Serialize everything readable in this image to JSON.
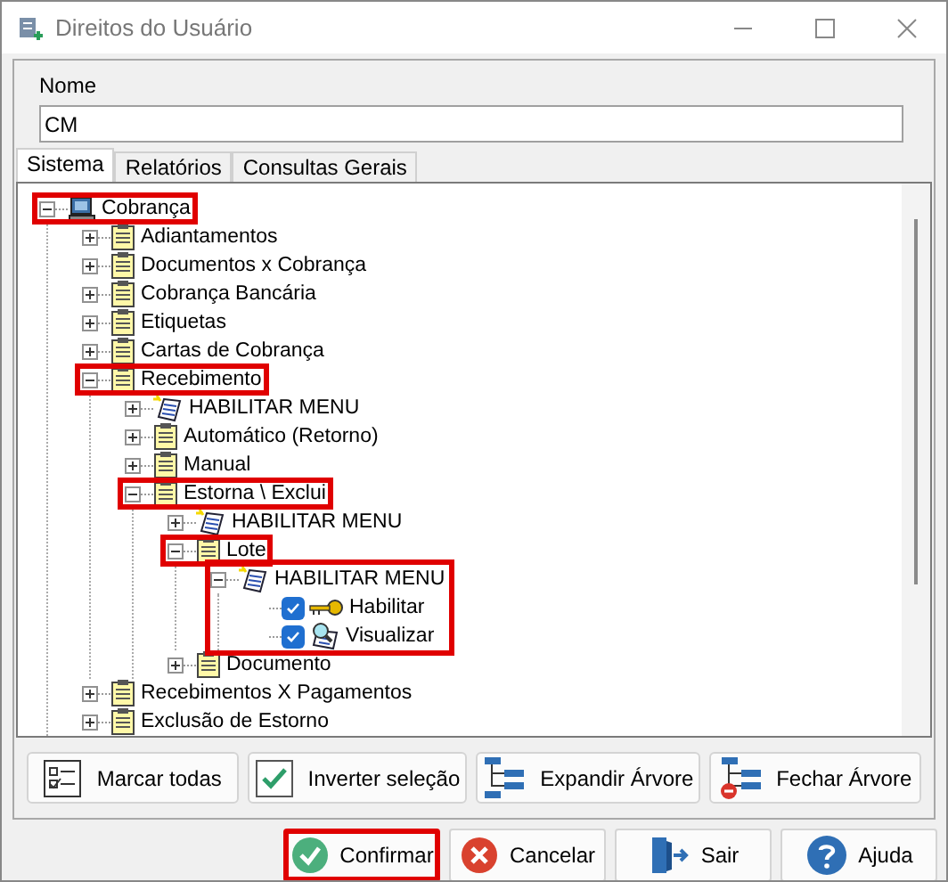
{
  "window": {
    "title": "Direitos do Usuário"
  },
  "name_field": {
    "label": "Nome",
    "value": "CM"
  },
  "tabs": [
    {
      "label": "Sistema",
      "selected": true
    },
    {
      "label": "Relatórios",
      "selected": false
    },
    {
      "label": "Consultas Gerais",
      "selected": false
    }
  ],
  "tree": [
    {
      "label": "Cobrança",
      "kind": "computer",
      "expanded": true,
      "highlighted": true,
      "children": [
        {
          "label": "Adiantamentos",
          "kind": "folder",
          "expanded": false,
          "highlighted": false
        },
        {
          "label": "Documentos x Cobrança",
          "kind": "folder",
          "expanded": false,
          "highlighted": false
        },
        {
          "label": "Cobrança Bancária",
          "kind": "folder",
          "expanded": false,
          "highlighted": false
        },
        {
          "label": "Etiquetas",
          "kind": "folder",
          "expanded": false,
          "highlighted": false
        },
        {
          "label": "Cartas de Cobrança",
          "kind": "folder",
          "expanded": false,
          "highlighted": false
        },
        {
          "label": "Recebimento",
          "kind": "folder",
          "expanded": true,
          "highlighted": true,
          "children": [
            {
              "label": "HABILITAR MENU",
              "kind": "menu",
              "expanded": false,
              "highlighted": false
            },
            {
              "label": "Automático (Retorno)",
              "kind": "folder",
              "expanded": false,
              "highlighted": false
            },
            {
              "label": "Manual",
              "kind": "folder",
              "expanded": false,
              "highlighted": false
            },
            {
              "label": "Estorna \\ Exclui",
              "kind": "folder",
              "expanded": true,
              "highlighted": true,
              "children": [
                {
                  "label": "HABILITAR MENU",
                  "kind": "menu",
                  "expanded": false,
                  "highlighted": false
                },
                {
                  "label": "Lote",
                  "kind": "folder",
                  "expanded": true,
                  "highlighted": true,
                  "children": [
                    {
                      "label": "HABILITAR MENU",
                      "kind": "menu",
                      "expanded": true,
                      "highlighted": true,
                      "children": [
                        {
                          "label": "Habilitar",
                          "kind": "key",
                          "checked": true
                        },
                        {
                          "label": "Visualizar",
                          "kind": "view",
                          "checked": true
                        }
                      ]
                    }
                  ]
                },
                {
                  "label": "Documento",
                  "kind": "folder",
                  "expanded": false,
                  "highlighted": false
                }
              ]
            }
          ]
        },
        {
          "label": "Recebimentos X Pagamentos",
          "kind": "folder",
          "expanded": false,
          "highlighted": false
        },
        {
          "label": "Exclusão de Estorno",
          "kind": "folder",
          "expanded": false,
          "highlighted": false
        }
      ]
    }
  ],
  "tree_buttons": [
    {
      "label": "Marcar todas",
      "kind": "mark"
    },
    {
      "label": "Inverter seleção",
      "kind": "invert"
    },
    {
      "label": "Expandir Árvore",
      "kind": "expand"
    },
    {
      "label": "Fechar Árvore",
      "kind": "collapse"
    }
  ],
  "dialog_buttons": [
    {
      "label": "Confirmar",
      "kind": "confirm",
      "highlighted": true
    },
    {
      "label": "Cancelar",
      "kind": "cancel",
      "highlighted": false
    },
    {
      "label": "Sair",
      "kind": "exit",
      "highlighted": false
    },
    {
      "label": "Ajuda",
      "kind": "help",
      "highlighted": false
    }
  ]
}
